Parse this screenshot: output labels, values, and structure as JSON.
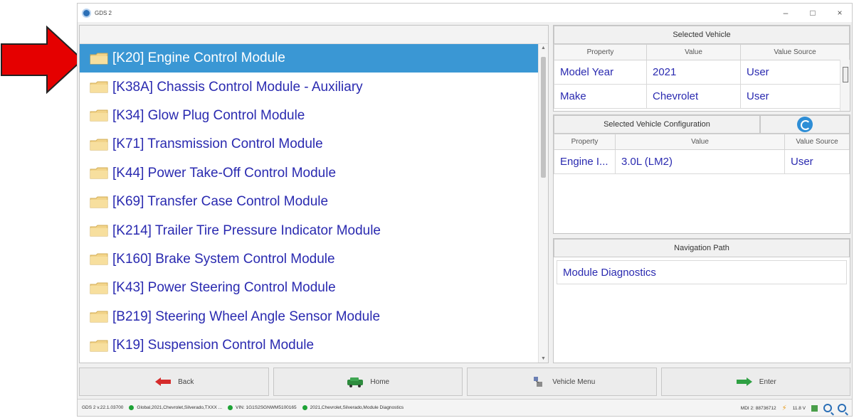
{
  "window": {
    "title": "GDS 2",
    "controls": {
      "minimize": "–",
      "maximize": "□",
      "close": "×"
    }
  },
  "modules": [
    {
      "label": "[K20] Engine Control Module",
      "selected": true
    },
    {
      "label": "[K38A] Chassis Control Module - Auxiliary"
    },
    {
      "label": "[K34] Glow Plug Control Module"
    },
    {
      "label": "[K71] Transmission Control Module"
    },
    {
      "label": "[K44] Power Take-Off Control Module"
    },
    {
      "label": "[K69] Transfer Case Control Module"
    },
    {
      "label": "[K214] Trailer Tire Pressure Indicator Module"
    },
    {
      "label": "[K160] Brake System Control Module"
    },
    {
      "label": "[K43] Power Steering Control Module"
    },
    {
      "label": "[B219] Steering Wheel Angle Sensor Module"
    },
    {
      "label": "[K19] Suspension Control Module"
    }
  ],
  "selected_vehicle": {
    "title": "Selected Vehicle",
    "headers": [
      "Property",
      "Value",
      "Value Source"
    ],
    "rows": [
      [
        "Model Year",
        "2021",
        "User"
      ],
      [
        "Make",
        "Chevrolet",
        "User"
      ]
    ]
  },
  "vehicle_config": {
    "title": "Selected Vehicle Configuration",
    "headers": [
      "Property",
      "Value",
      "Value Source"
    ],
    "rows": [
      [
        "Engine I...",
        "3.0L (LM2)",
        "User"
      ]
    ]
  },
  "navigation": {
    "title": "Navigation Path",
    "path": "Module Diagnostics"
  },
  "buttons": {
    "back": "Back",
    "home": "Home",
    "vehicle_menu": "Vehicle Menu",
    "enter": "Enter"
  },
  "status": {
    "version": "GDS 2 v.22.1.03700",
    "global": "Global,2021,Chevrolet,Silverado,TXXX ...",
    "vin": "VIN: 1G1S2SGNWM5100165",
    "path": "2021,Chevrolet,Silverado,Module Diagnostics",
    "mdi": "MDI 2: 88736712",
    "voltage": "11.8 V"
  },
  "colors": {
    "selection": "#3a97d4",
    "link_text": "#2a2ab0",
    "arrow": "#e50000",
    "status_ok": "#1ea336"
  }
}
